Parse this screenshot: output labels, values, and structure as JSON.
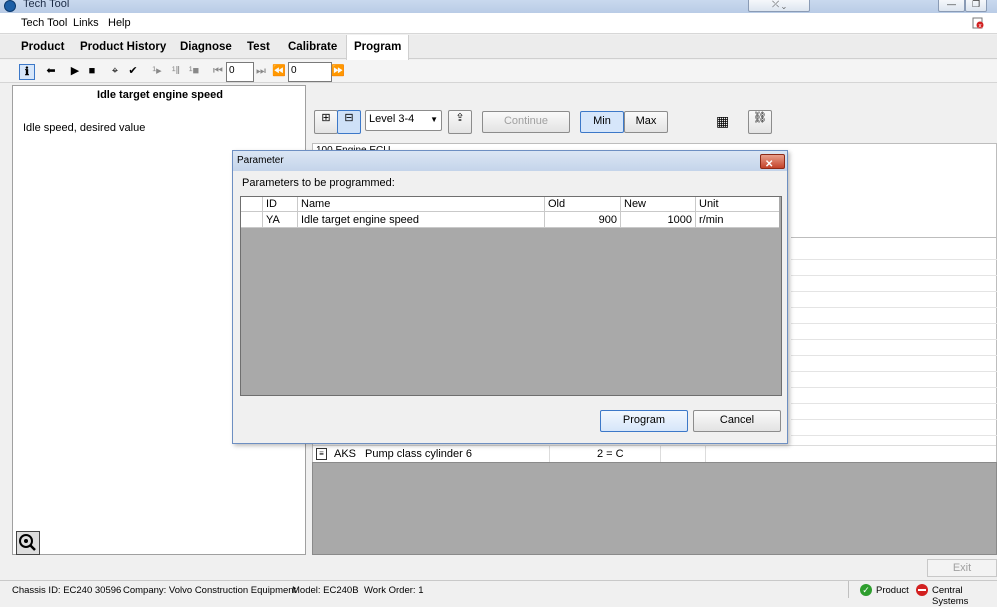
{
  "window": {
    "title": "Tech Tool"
  },
  "menu": [
    "Tech Tool",
    "Links",
    "Help"
  ],
  "nav_tabs": [
    "Product",
    "Product History",
    "Diagnose",
    "Test",
    "Calibrate",
    "Program"
  ],
  "toolbar": {
    "field1_value": "0",
    "field2_value": "0"
  },
  "left_pane": {
    "title": "Idle target engine speed",
    "description": "Idle speed, desired value"
  },
  "right_panel": {
    "level_select": "Level 3-4",
    "continue_label": "Continue",
    "min_label": "Min",
    "max_label": "Max",
    "partial_row": "100  Engine ECU",
    "row": {
      "id": "AKS",
      "name": "Pump class cylinder 6",
      "value": "2 = C"
    }
  },
  "dialog": {
    "title": "Parameter",
    "subtitle": "Parameters to be programmed:",
    "headers": {
      "id": "ID",
      "name": "Name",
      "old": "Old",
      "new": "New",
      "unit": "Unit"
    },
    "rows": [
      {
        "id": "YA",
        "name": "Idle target engine speed",
        "old": "900",
        "new": "1000",
        "unit": "r/min"
      }
    ],
    "program_label": "Program",
    "cancel_label": "Cancel"
  },
  "exit_label": "Exit",
  "status": {
    "chassis": "Chassis ID: EC240 30596",
    "company": "Company: Volvo Construction Equipment",
    "model": "Model: EC240B",
    "work_order": "Work Order: 1",
    "product": "Product",
    "central_systems": "Central Systems"
  },
  "colors": {
    "status_ok": "#2e9e2e",
    "status_error": "#d22020",
    "dialog_border": "#6d8fc2",
    "grid_gray": "#a9a9a9"
  }
}
